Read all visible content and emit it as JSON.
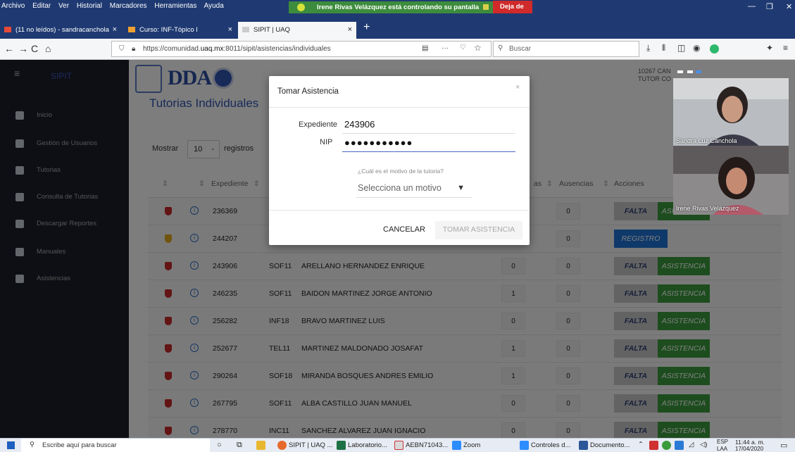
{
  "browser": {
    "menu": [
      "Archivo",
      "Editar",
      "Ver",
      "Historial",
      "Marcadores",
      "Herramientas",
      "Ayuda"
    ],
    "share_message": "Irene Rivas Velázquez está controlando su pantalla",
    "stop_share": "Deja de",
    "tabs": [
      {
        "label": "(11 no leídos) - sandracanchola",
        "close": "×"
      },
      {
        "label": "Curso: INF-Tópico I",
        "close": "×"
      },
      {
        "label": "SIPIT | UAQ",
        "close": "×"
      }
    ],
    "new_tab": "+",
    "url_prefix": "https://comunidad.",
    "url_domain": "uaq.mx",
    "url_rest": ":8011/sipit/asistencias/individuales",
    "search_placeholder": "Buscar",
    "nav": {
      "back": "←",
      "forward": "→",
      "reload": "C",
      "home": "⌂",
      "more": "···",
      "pocket": "♡",
      "star": "☆"
    }
  },
  "app": {
    "brand": "SIPIT",
    "menu_icon": "≡",
    "logo_text": "DDA",
    "page_title": "Tutorias Individuales",
    "user_line1": "10267 CAN",
    "user_line2": "TUTOR CO",
    "sidebar": [
      {
        "label": "Inicio",
        "icon": "home-icon"
      },
      {
        "label": "Gestión de Usuarios",
        "icon": "users-icon"
      },
      {
        "label": "Tutorias",
        "icon": "clipboard-icon"
      },
      {
        "label": "Consulta de Tutorias",
        "icon": "search-icon"
      },
      {
        "label": "Descargar Reportes",
        "icon": "download-icon"
      },
      {
        "label": "Manuales",
        "icon": "file-icon"
      },
      {
        "label": "Asistencias",
        "icon": "calendar-icon"
      }
    ],
    "show_label": "Mostrar",
    "entries_value": "10",
    "entries_after": "registros",
    "columns": {
      "expediente": "Expediente",
      "asistencias": "as",
      "ausencias": "Ausencias",
      "acciones": "Acciones"
    },
    "sort_glyph": "⇕",
    "buttons": {
      "falta": "FALTA",
      "asistencia": "ASISTENCIA",
      "registro": "REGISTRO"
    },
    "rows": [
      {
        "exp": "236369",
        "grp": "",
        "name": "",
        "asis": "",
        "aus": "0",
        "shield": "#c62828",
        "action": "falta"
      },
      {
        "exp": "244207",
        "grp": "",
        "name": "",
        "asis": "",
        "aus": "0",
        "shield": "#e2a81e",
        "action": "registro"
      },
      {
        "exp": "243906",
        "grp": "SOF11",
        "name": "ARELLANO HERNANDEZ ENRIQUE",
        "asis": "0",
        "aus": "0",
        "shield": "#c62828",
        "action": "falta"
      },
      {
        "exp": "246235",
        "grp": "SOF11",
        "name": "BAIDON MARTINEZ JORGE ANTONIO",
        "asis": "1",
        "aus": "0",
        "shield": "#c62828",
        "action": "falta"
      },
      {
        "exp": "256282",
        "grp": "INF18",
        "name": "BRAVO MARTINEZ LUIS",
        "asis": "0",
        "aus": "0",
        "shield": "#c62828",
        "action": "falta"
      },
      {
        "exp": "252677",
        "grp": "TEL11",
        "name": "MARTINEZ MALDONADO JOSAFAT",
        "asis": "1",
        "aus": "0",
        "shield": "#c62828",
        "action": "falta"
      },
      {
        "exp": "290264",
        "grp": "SOF18",
        "name": "MIRANDA BOSQUES ANDRES EMILIO",
        "asis": "1",
        "aus": "0",
        "shield": "#c62828",
        "action": "falta"
      },
      {
        "exp": "267795",
        "grp": "SOF11",
        "name": "ALBA CASTILLO JUAN MANUEL",
        "asis": "0",
        "aus": "0",
        "shield": "#c62828",
        "action": "falta"
      },
      {
        "exp": "278770",
        "grp": "INC11",
        "name": "SANCHEZ ALVAREZ JUAN IGNACIO",
        "asis": "0",
        "aus": "0",
        "shield": "#c62828",
        "action": "falta"
      }
    ]
  },
  "modal": {
    "title": "Tomar Asistencia",
    "close": "×",
    "exp_label": "Expediente",
    "exp_value": "243906",
    "nip_label": "NIP",
    "nip_value": "●●●●●●●●●●●",
    "motive_question": "¿Cuál es el motivo de la tutoria?",
    "motive_placeholder": "Selecciona un motivo",
    "cancel": "CANCELAR",
    "take": "TOMAR ASISTENCIA"
  },
  "video": {
    "participant1": "Sandra Luz Canchola",
    "participant2": "Irene Rivas Velázquez"
  },
  "taskbar": {
    "search": "Escribe aquí para buscar",
    "items": [
      "SIPIT | UAQ ...",
      "Laboratorio...",
      "AEBN71043...",
      "Zoom",
      "Controles d...",
      "Documento..."
    ],
    "lang1": "ESP",
    "lang2": "LAA",
    "time": "11:44 a. m.",
    "date": "17/04/2020"
  }
}
